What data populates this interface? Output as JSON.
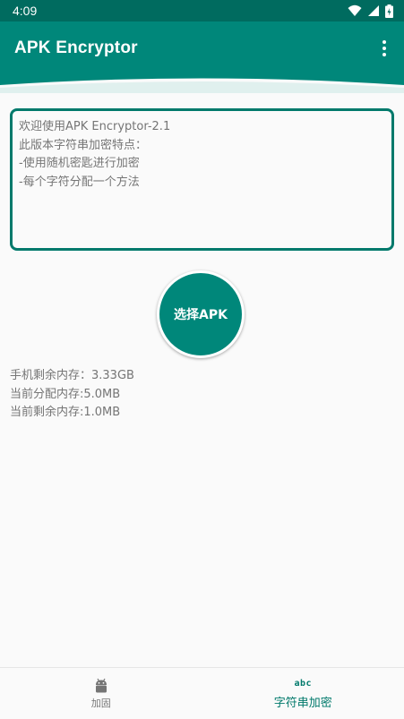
{
  "status_bar": {
    "time": "4:09"
  },
  "app_bar": {
    "title": "APK Encryptor"
  },
  "main": {
    "log_text": "欢迎使用APK Encryptor-2.1\n此版本字符串加密特点：\n-使用随机密匙进行加密\n-每个字符分配一个方法",
    "select_button_label": "选择APK",
    "info": [
      "手机剩余内存：3.33GB",
      "当前分配内存:5.0MB",
      "当前剩余内存:1.0MB"
    ]
  },
  "bottom_nav": {
    "items": [
      {
        "label": "加固",
        "icon": "android-icon",
        "active": false
      },
      {
        "label": "字符串加密",
        "icon": "abc-icon",
        "icon_text": "abc",
        "active": true
      }
    ]
  },
  "colors": {
    "status_bar": "#006b5f",
    "primary": "#00877a",
    "accent": "#00796b",
    "background": "#fafafa",
    "text_secondary": "#757575"
  }
}
